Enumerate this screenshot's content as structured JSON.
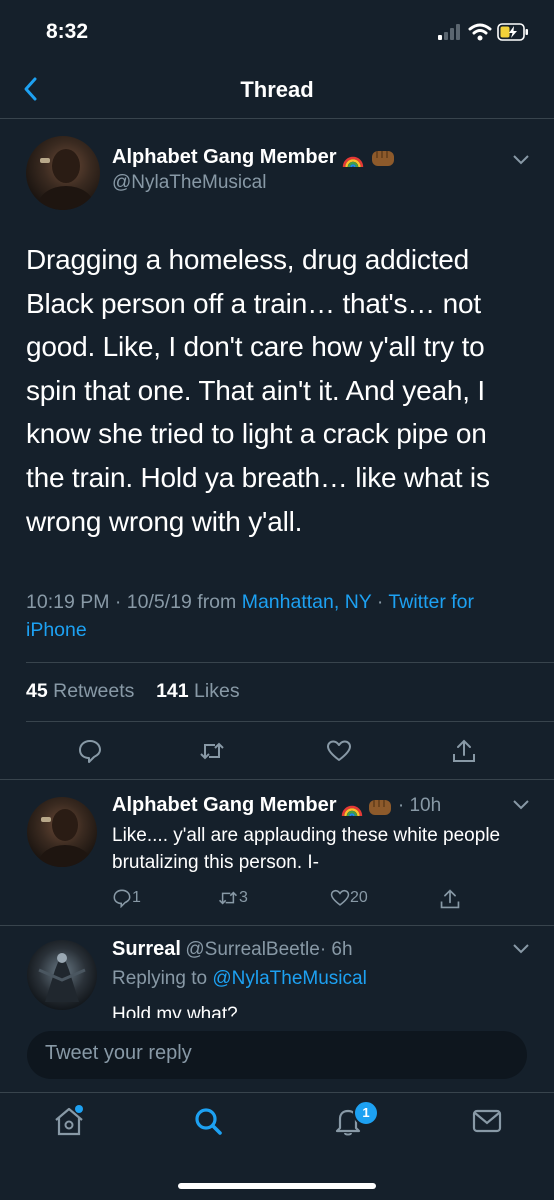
{
  "status_bar": {
    "time": "8:32"
  },
  "nav": {
    "title": "Thread"
  },
  "main_tweet": {
    "name": "Alphabet Gang Member",
    "handle": "@NylaTheMusical",
    "text": "Dragging a homeless, drug addicted Black person off a train… that's… not good. Like, I don't care how y'all try to spin that one. That ain't it. And yeah, I know she tried to light a crack pipe on the train. Hold ya breath… like what is wrong wrong with y'all.",
    "meta_time": "10:19 PM · 10/5/19 from ",
    "location": "Manhattan, NY",
    "sep": " · ",
    "source": "Twitter for iPhone",
    "retweets": "45",
    "retweets_label": " Retweets",
    "likes": "141",
    "likes_label": " Likes"
  },
  "replies": [
    {
      "name": "Alphabet Gang Member",
      "time": "· 10h",
      "text": "Like.... y'all are applauding these white people brutalizing this person. I-",
      "reply_count": "1",
      "retweet_count": "3",
      "like_count": "20"
    },
    {
      "name": "Surreal",
      "handle": "@SurrealBeetle",
      "time": "· 6h",
      "replying_prefix": "Replying to ",
      "replying_to": "@NylaTheMusical",
      "text": "Hold my what?"
    }
  ],
  "composer": {
    "placeholder": "Tweet your reply"
  },
  "tabbar": {
    "notification_badge": "1"
  },
  "colors": {
    "background": "#15202b",
    "accent": "#1da1f2",
    "secondary_text": "#8899a6",
    "divider": "#38444d"
  },
  "icons": [
    "back-chevron-icon",
    "chevron-down-icon",
    "reply-icon",
    "retweet-icon",
    "like-icon",
    "share-icon",
    "home-icon",
    "search-icon",
    "notifications-icon",
    "messages-icon"
  ]
}
